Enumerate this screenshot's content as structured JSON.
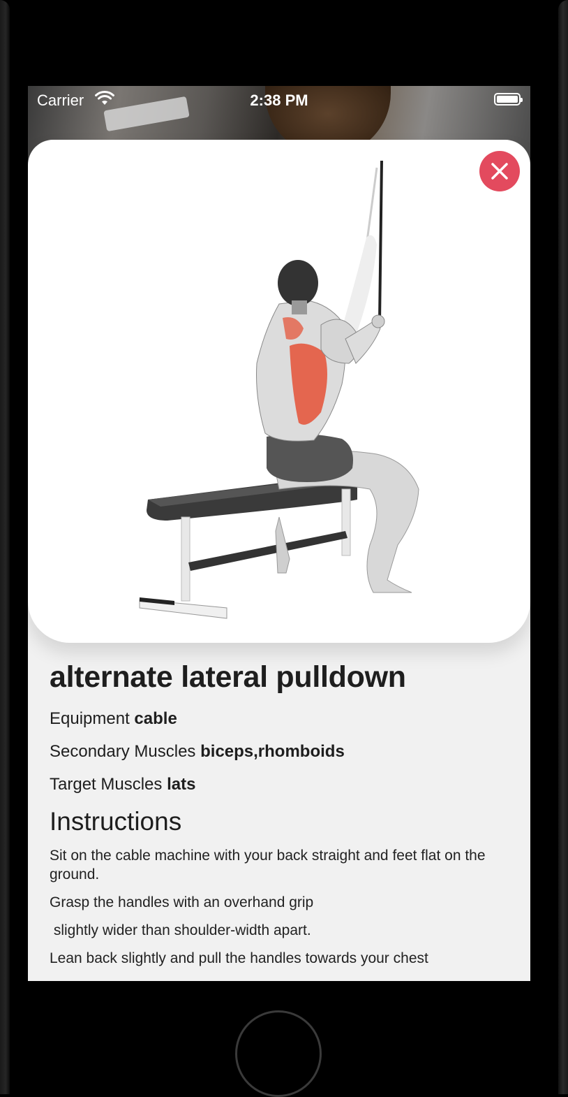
{
  "status_bar": {
    "carrier": "Carrier",
    "time": "2:38 PM"
  },
  "exercise": {
    "name": "alternate lateral pulldown",
    "equipment_label": "Equipment",
    "equipment_value": "cable",
    "secondary_label": "Secondary Muscles",
    "secondary_value": "biceps,rhomboids",
    "target_label": "Target Muscles",
    "target_value": "lats",
    "instructions_title": "Instructions",
    "instructions": [
      "Sit on the cable machine with your back straight and feet flat on the ground.",
      "Grasp the handles with an overhand grip",
      " slightly wider than shoulder-width apart.",
      "Lean back slightly and pull the handles towards your chest"
    ]
  },
  "colors": {
    "close_button": "#e34a5e",
    "highlight_muscle": "#e4664f",
    "background": "#f1f1f1"
  },
  "icons": {
    "close": "close-icon",
    "wifi": "wifi-icon",
    "battery": "battery-icon"
  }
}
